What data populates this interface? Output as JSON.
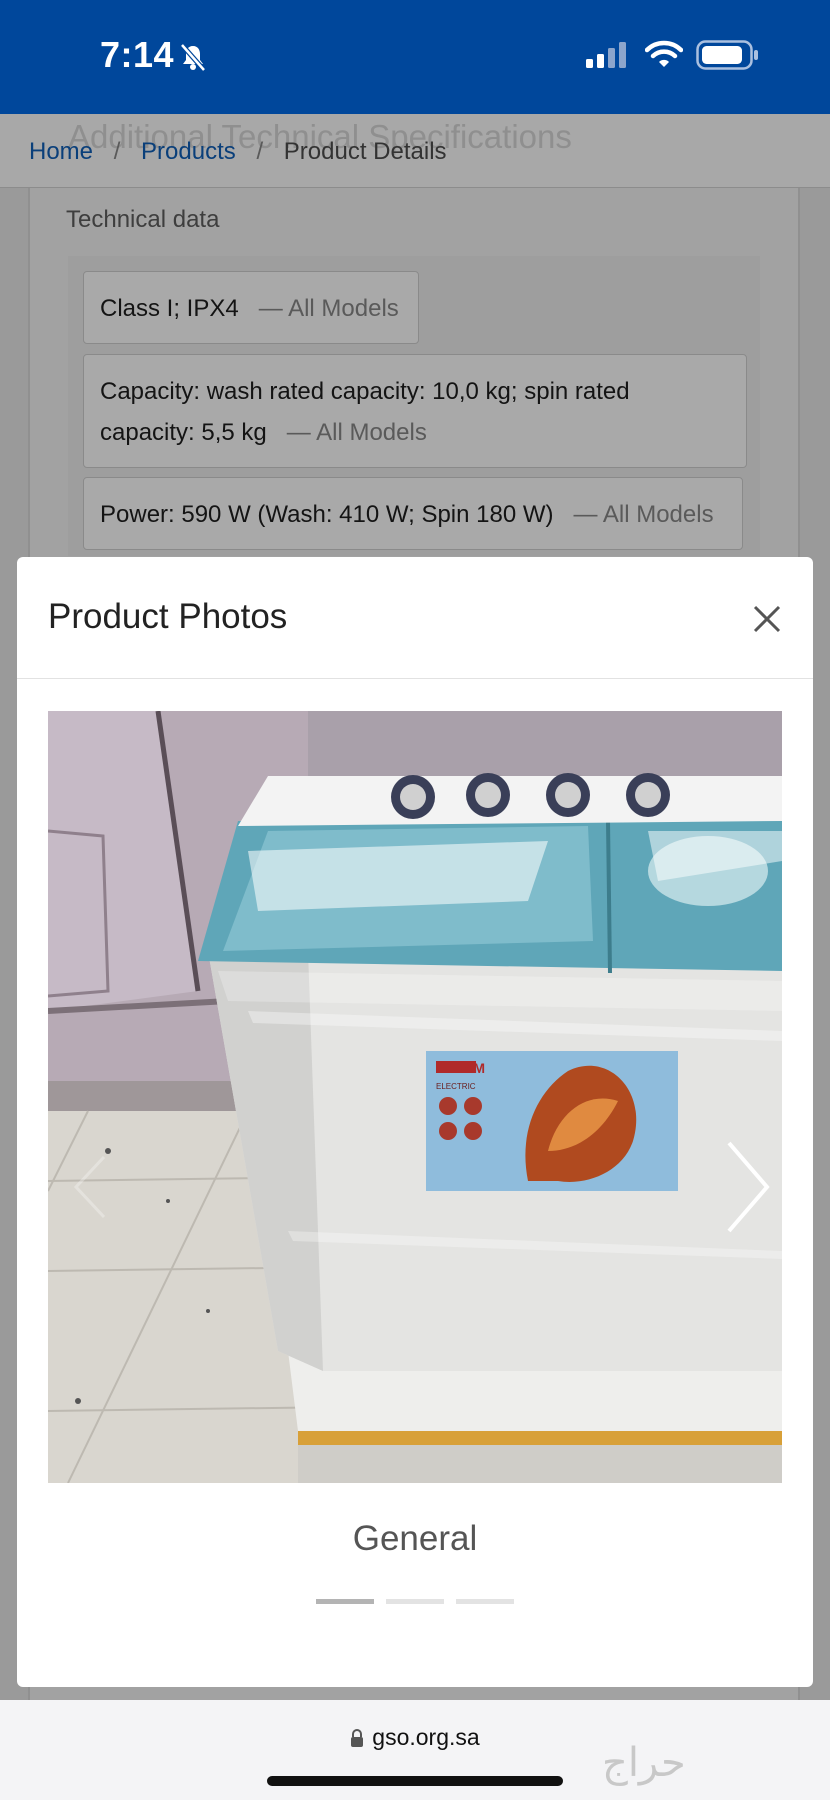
{
  "status_bar": {
    "time": "7:14",
    "icons": [
      "bell-slash-icon",
      "signal-icon",
      "wifi-icon",
      "battery-icon"
    ]
  },
  "background_page": {
    "ghost_heading": "Additional Technical Specifications",
    "breadcrumb": {
      "home": "Home",
      "separator": "/",
      "products": "Products",
      "current": "Product Details"
    },
    "section_title": "Technical data",
    "specs": [
      {
        "text": "Class I; IPX4",
        "models": "— All Models"
      },
      {
        "text_line1": "Capacity: wash rated capacity: 10,0 kg; spin rated",
        "text_line2": "capacity: 5,5 kg",
        "models": "— All Models"
      },
      {
        "text": "Power: 590 W (Wash: 410 W; Spin 180 W)",
        "models": "— All Models"
      }
    ]
  },
  "modal": {
    "title": "Product Photos",
    "close_icon": "close-icon",
    "photo": {
      "subject": "twin-tub washing machine",
      "sticker_brand": "HAAM",
      "sticker_sub": "ELECTRIC"
    },
    "caption": "General",
    "slide_count": 3,
    "active_slide": 1
  },
  "url_bar": {
    "domain": "gso.org.sa",
    "watermark": "حراج"
  },
  "colors": {
    "status_bar": "#00479b",
    "link": "#0a3f7a",
    "indicator_active": "#b4b4b4"
  }
}
